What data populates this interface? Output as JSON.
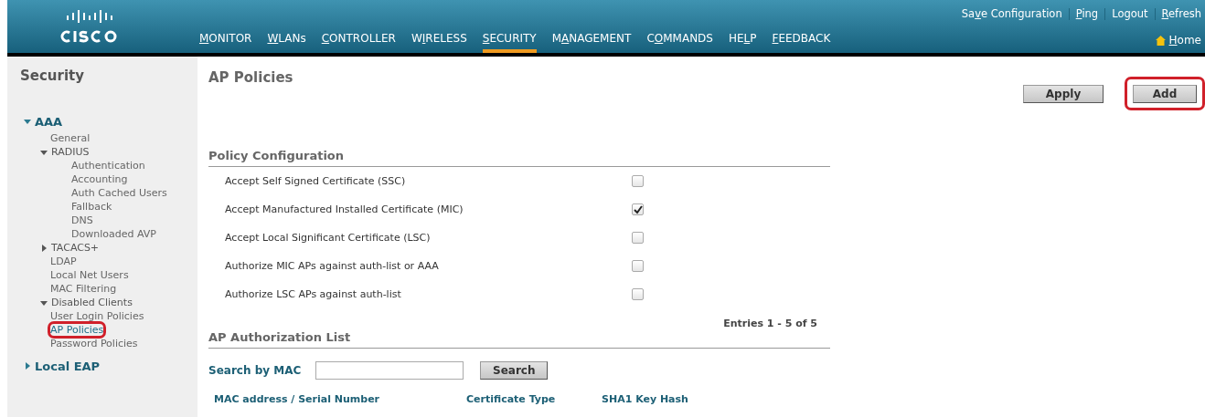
{
  "top_links": [
    {
      "pre": "Sa",
      "key": "v",
      "post": "e Configuration"
    },
    {
      "key": "P",
      "post": "ing"
    },
    {
      "pre": "Logout"
    },
    {
      "key": "R",
      "post": "efresh"
    }
  ],
  "nav": [
    {
      "key": "M",
      "post": "ONITOR",
      "selected": false
    },
    {
      "key": "W",
      "post": "LANs",
      "selected": false
    },
    {
      "key": "C",
      "post": "ONTROLLER",
      "selected": false
    },
    {
      "pre": "W",
      "key": "I",
      "post": "RELESS",
      "selected": false
    },
    {
      "key": "S",
      "post": "ECURITY",
      "selected": true
    },
    {
      "pre": "M",
      "key": "A",
      "post": "NAGEMENT",
      "selected": false
    },
    {
      "pre": "C",
      "key": "O",
      "post": "MMANDS",
      "selected": false
    },
    {
      "pre": "HE",
      "key": "L",
      "post": "P",
      "selected": false
    },
    {
      "key": "F",
      "post": "EEDBACK",
      "selected": false
    }
  ],
  "home": {
    "key": "H",
    "post": "ome"
  },
  "sidebar": {
    "title": "Security",
    "items": [
      {
        "label": "AAA",
        "kind": "section",
        "expanded": true,
        "highlighted": false,
        "children": [
          {
            "label": "General",
            "kind": "link",
            "selected": false,
            "highlighted": false
          },
          {
            "label": "RADIUS",
            "kind": "group",
            "expanded": true,
            "selected": false,
            "highlighted": false,
            "children": [
              {
                "label": "Authentication",
                "kind": "link",
                "selected": false,
                "highlighted": false
              },
              {
                "label": "Accounting",
                "kind": "link",
                "selected": false,
                "highlighted": false
              },
              {
                "label": "Auth Cached Users",
                "kind": "link",
                "selected": false,
                "highlighted": false
              },
              {
                "label": "Fallback",
                "kind": "link",
                "selected": false,
                "highlighted": false
              },
              {
                "label": "DNS",
                "kind": "link",
                "selected": false,
                "highlighted": false
              },
              {
                "label": "Downloaded AVP",
                "kind": "link",
                "selected": false,
                "highlighted": false
              }
            ]
          },
          {
            "label": "TACACS+",
            "kind": "group",
            "expanded": false,
            "selected": false,
            "highlighted": false
          },
          {
            "label": "LDAP",
            "kind": "link",
            "selected": false,
            "highlighted": false
          },
          {
            "label": "Local Net Users",
            "kind": "link",
            "selected": false,
            "highlighted": false
          },
          {
            "label": "MAC Filtering",
            "kind": "link",
            "selected": false,
            "highlighted": false
          },
          {
            "label": "Disabled Clients",
            "kind": "group",
            "expanded": true,
            "selected": false,
            "highlighted": false
          },
          {
            "label": "User Login Policies",
            "kind": "link",
            "selected": false,
            "highlighted": false
          },
          {
            "label": "AP Policies",
            "kind": "link",
            "selected": true,
            "highlighted": true
          },
          {
            "label": "Password Policies",
            "kind": "link",
            "selected": false,
            "highlighted": false
          }
        ]
      },
      {
        "label": "Local EAP",
        "kind": "section",
        "expanded": false,
        "highlighted": false
      }
    ]
  },
  "page_title": "AP Policies",
  "buttons": [
    {
      "label": "Apply",
      "highlighted": false
    },
    {
      "label": "Add",
      "highlighted": true
    }
  ],
  "policy_section": {
    "heading": "Policy Configuration",
    "options": [
      {
        "label": "Accept Self Signed Certificate (SSC)",
        "checked": false
      },
      {
        "label": "Accept Manufactured Installed Certificate (MIC)",
        "checked": true
      },
      {
        "label": "Accept Local Significant Certificate (LSC)",
        "checked": false
      },
      {
        "label": "Authorize MIC APs against auth-list or AAA",
        "checked": false
      },
      {
        "label": "Authorize LSC APs against auth-list",
        "checked": false
      }
    ]
  },
  "auth_list": {
    "heading": "AP Authorization List",
    "entries": "Entries 1 - 5 of 5",
    "search_label": "Search by MAC",
    "search_button": "Search",
    "columns": [
      "MAC address / Serial Number",
      "Certificate Type",
      "SHA1 Key Hash"
    ]
  }
}
